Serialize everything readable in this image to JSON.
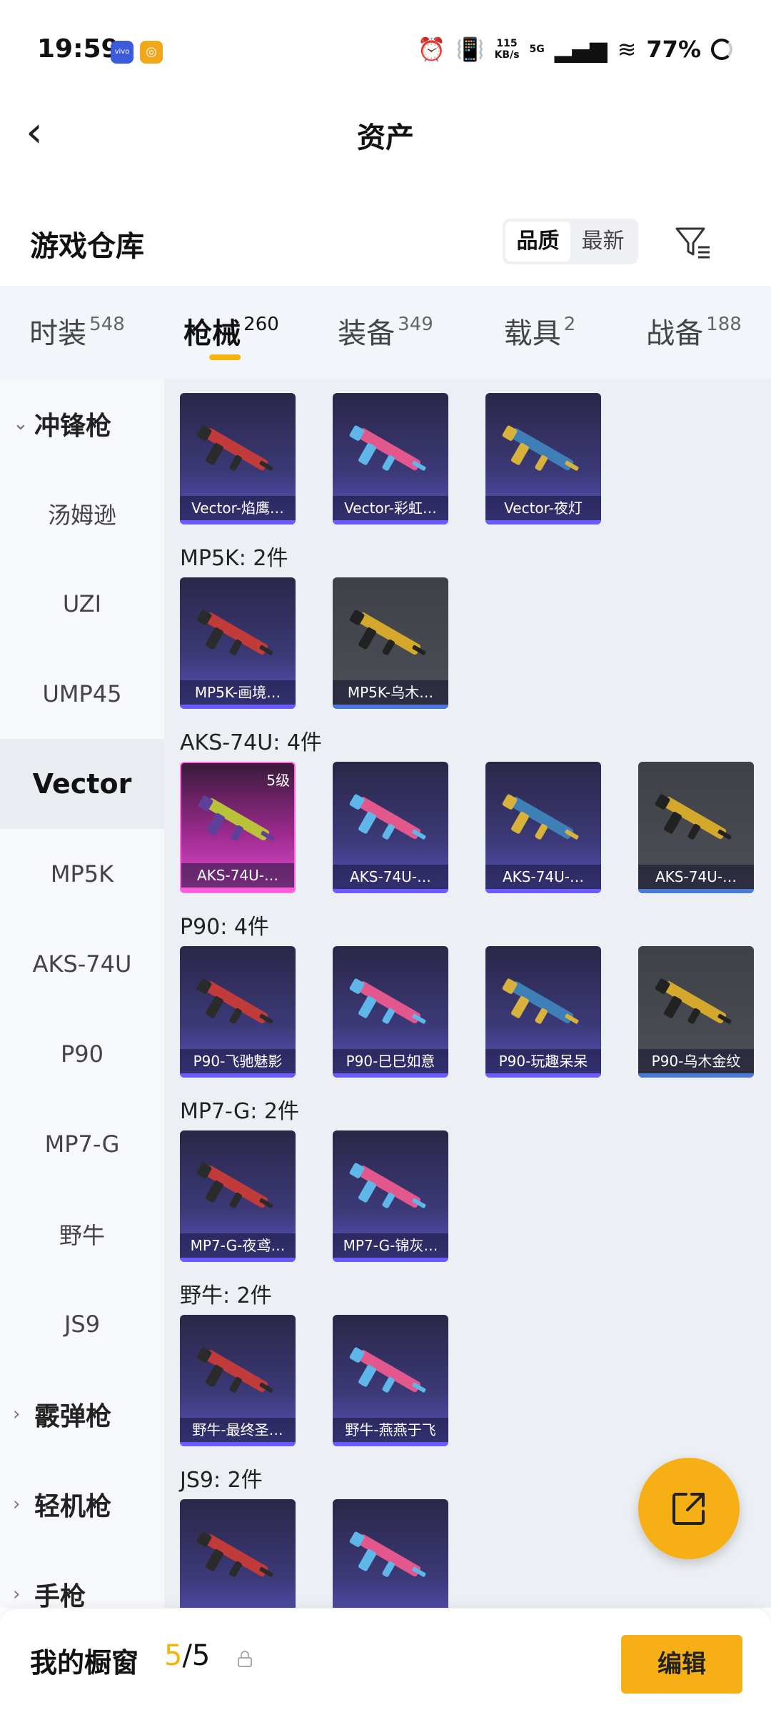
{
  "status": {
    "time": "19:59",
    "speed_top": "115",
    "speed_bottom": "KB/s",
    "network": "5G",
    "battery": "77%"
  },
  "header": {
    "title": "资产",
    "back_icon": "chevron-left-icon"
  },
  "warehouse": {
    "title": "游戏仓库",
    "sort_options": [
      "品质",
      "最新"
    ],
    "active_sort": "品质",
    "filter_icon": "filter-icon"
  },
  "tabs": [
    {
      "label": "时装",
      "count": "548"
    },
    {
      "label": "枪械",
      "count": "260"
    },
    {
      "label": "装备",
      "count": "349"
    },
    {
      "label": "载具",
      "count": "2"
    },
    {
      "label": "战备",
      "count": "188"
    }
  ],
  "active_tab": "枪械",
  "sidebar": [
    {
      "label": "冲锋枪",
      "group": true
    },
    {
      "label": "汤姆逊"
    },
    {
      "label": "UZI"
    },
    {
      "label": "UMP45"
    },
    {
      "label": "Vector",
      "active": true
    },
    {
      "label": "MP5K"
    },
    {
      "label": "AKS-74U"
    },
    {
      "label": "P90"
    },
    {
      "label": "MP7-G"
    },
    {
      "label": "野牛"
    },
    {
      "label": "JS9"
    },
    {
      "label": "霰弹枪",
      "group": true
    },
    {
      "label": "轻机枪",
      "group": true
    },
    {
      "label": "手枪",
      "group": true
    }
  ],
  "sections": [
    {
      "label": "",
      "items": [
        {
          "name": "Vector-焰鹰…",
          "style": "purple"
        },
        {
          "name": "Vector-彩虹…",
          "style": "purple"
        },
        {
          "name": "Vector-夜灯",
          "style": "purple"
        }
      ]
    },
    {
      "label": "MP5K: 2件",
      "items": [
        {
          "name": "MP5K-画境…",
          "style": "purple"
        },
        {
          "name": "MP5K-乌木…",
          "style": "gray"
        }
      ]
    },
    {
      "label": "AKS-74U: 4件",
      "items": [
        {
          "name": "AKS-74U-…",
          "style": "pink",
          "level": "5级"
        },
        {
          "name": "AKS-74U-…",
          "style": "purple"
        },
        {
          "name": "AKS-74U-…",
          "style": "purple"
        },
        {
          "name": "AKS-74U-…",
          "style": "gray"
        }
      ]
    },
    {
      "label": "P90: 4件",
      "items": [
        {
          "name": "P90-飞驰魅影",
          "style": "purple"
        },
        {
          "name": "P90-巳巳如意",
          "style": "purple"
        },
        {
          "name": "P90-玩趣呆呆",
          "style": "purple"
        },
        {
          "name": "P90-乌木金纹",
          "style": "gray"
        }
      ]
    },
    {
      "label": "MP7-G: 2件",
      "items": [
        {
          "name": "MP7-G-夜鸢…",
          "style": "purple"
        },
        {
          "name": "MP7-G-锦灰…",
          "style": "purple"
        }
      ]
    },
    {
      "label": "野牛: 2件",
      "items": [
        {
          "name": "野牛-最终圣…",
          "style": "purple"
        },
        {
          "name": "野牛-燕燕于飞",
          "style": "purple"
        }
      ]
    },
    {
      "label": "JS9: 2件",
      "items": [
        {
          "name": "",
          "style": "purple"
        },
        {
          "name": "",
          "style": "purple"
        }
      ]
    }
  ],
  "bottom": {
    "title": "我的橱窗",
    "count_current": "5",
    "count_sep": "/5",
    "edit_label": "编辑"
  },
  "fab_icon": "share-external-icon"
}
